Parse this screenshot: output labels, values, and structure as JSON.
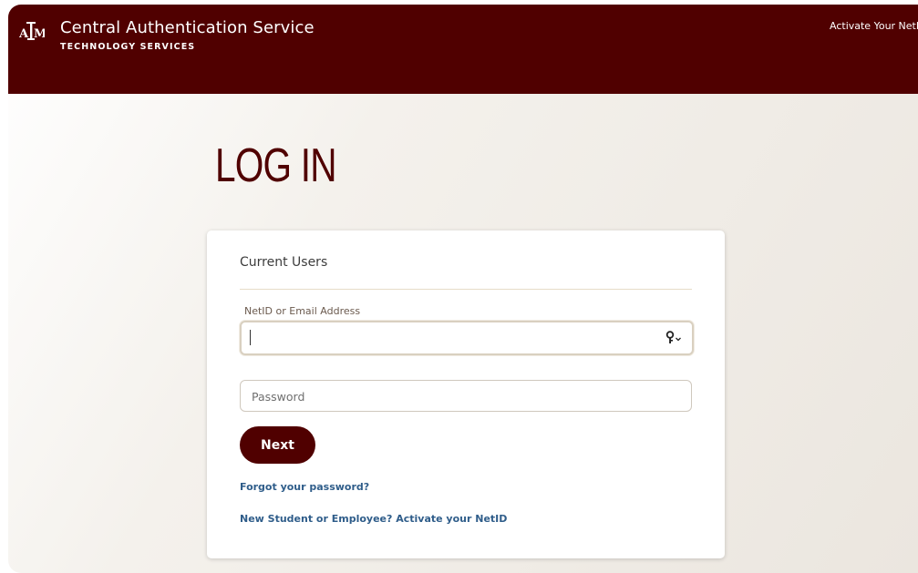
{
  "header": {
    "logo_icon": "atm-logo-icon",
    "logo_text": "ATM",
    "title": "Central Authentication Service",
    "subtitle": "TECHNOLOGY SERVICES",
    "activate_link": "Activate Your NetID",
    "background_color": "#500000"
  },
  "main": {
    "page_title": "LOG IN",
    "card": {
      "section_heading": "Current Users",
      "netid_field": {
        "label": "NetID or Email Address",
        "value": "",
        "icon": "password-manager-key-icon"
      },
      "password_field": {
        "placeholder": "Password",
        "value": ""
      },
      "next_button": "Next",
      "forgot_password_link": "Forgot your password?",
      "activate_netid_link": "New Student or Employee? Activate your NetID"
    }
  },
  "colors": {
    "brand_maroon": "#500000",
    "link_blue": "#2f5d8a"
  }
}
